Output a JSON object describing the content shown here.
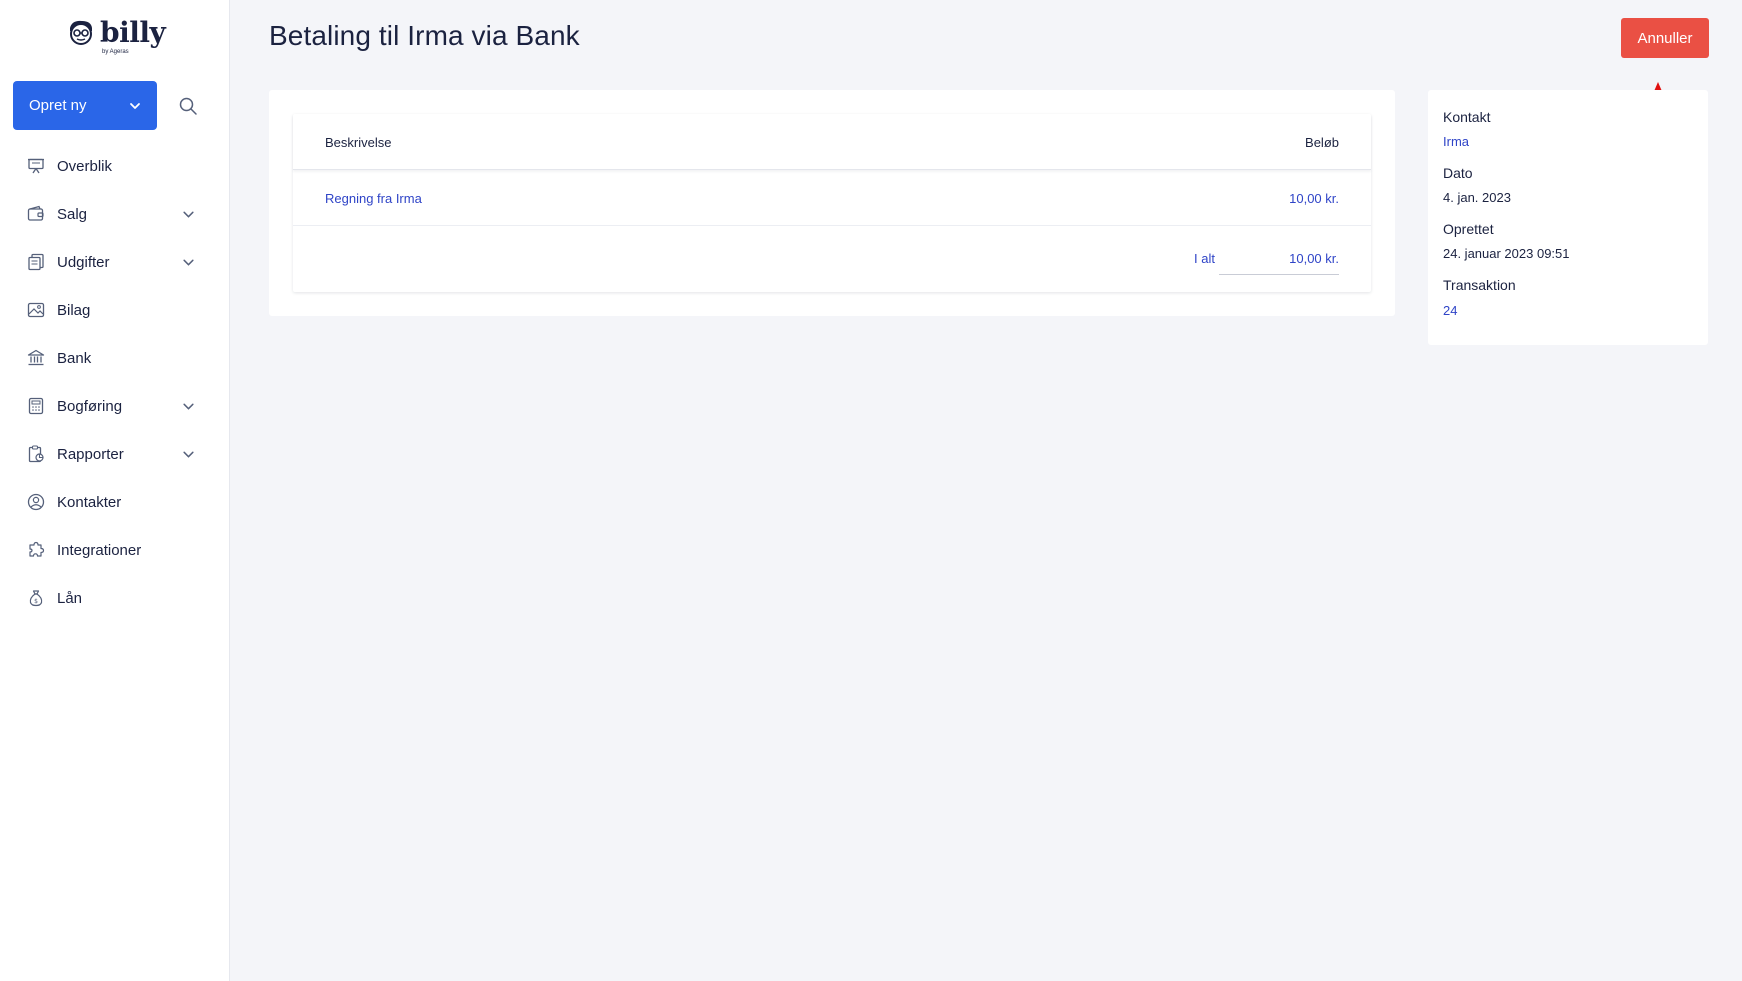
{
  "logo": {
    "word": "billy",
    "sub": "by Ageras"
  },
  "sidebar": {
    "create_label": "Opret ny",
    "items": [
      {
        "label": "Overblik",
        "icon": "presentation-icon",
        "expandable": false
      },
      {
        "label": "Salg",
        "icon": "wallet-icon",
        "expandable": true
      },
      {
        "label": "Udgifter",
        "icon": "receipts-icon",
        "expandable": true
      },
      {
        "label": "Bilag",
        "icon": "image-icon",
        "expandable": false
      },
      {
        "label": "Bank",
        "icon": "bank-icon",
        "expandable": false
      },
      {
        "label": "Bogføring",
        "icon": "calculator-icon",
        "expandable": true
      },
      {
        "label": "Rapporter",
        "icon": "report-icon",
        "expandable": true
      },
      {
        "label": "Kontakter",
        "icon": "user-circle-icon",
        "expandable": false
      },
      {
        "label": "Integrationer",
        "icon": "puzzle-icon",
        "expandable": false
      },
      {
        "label": "Lån",
        "icon": "money-bag-icon",
        "expandable": false
      }
    ]
  },
  "header": {
    "title": "Betaling til Irma via Bank",
    "cancel_label": "Annuller"
  },
  "table": {
    "col_description": "Beskrivelse",
    "col_amount": "Beløb",
    "rows": [
      {
        "description": "Regning fra Irma",
        "amount": "10,00 kr."
      }
    ],
    "total_label": "I alt",
    "total_value": "10,00 kr."
  },
  "details": {
    "contact_label": "Kontakt",
    "contact_value": "Irma",
    "date_label": "Dato",
    "date_value": "4. jan. 2023",
    "created_label": "Oprettet",
    "created_value": "24. januar 2023 09:51",
    "transaction_label": "Transaktion",
    "transaction_value": "24"
  },
  "colors": {
    "primary": "#2a66e8",
    "danger": "#ea5044",
    "link": "#2f44c7",
    "annotation_arrow": "#e01010"
  }
}
